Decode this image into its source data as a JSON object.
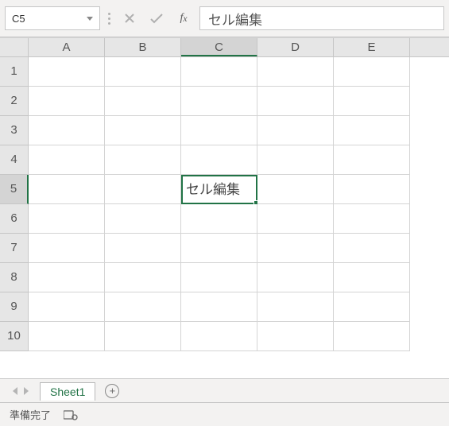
{
  "formula_bar": {
    "name_box": "C5",
    "formula_value": "セル編集"
  },
  "grid": {
    "columns": [
      "A",
      "B",
      "C",
      "D",
      "E"
    ],
    "rows": [
      "1",
      "2",
      "3",
      "4",
      "5",
      "6",
      "7",
      "8",
      "9",
      "10"
    ],
    "active_col_index": 2,
    "active_row_index": 4,
    "cells": {
      "C5": "セル編集"
    }
  },
  "tabs": {
    "active_sheet": "Sheet1"
  },
  "status": {
    "text": "準備完了"
  }
}
